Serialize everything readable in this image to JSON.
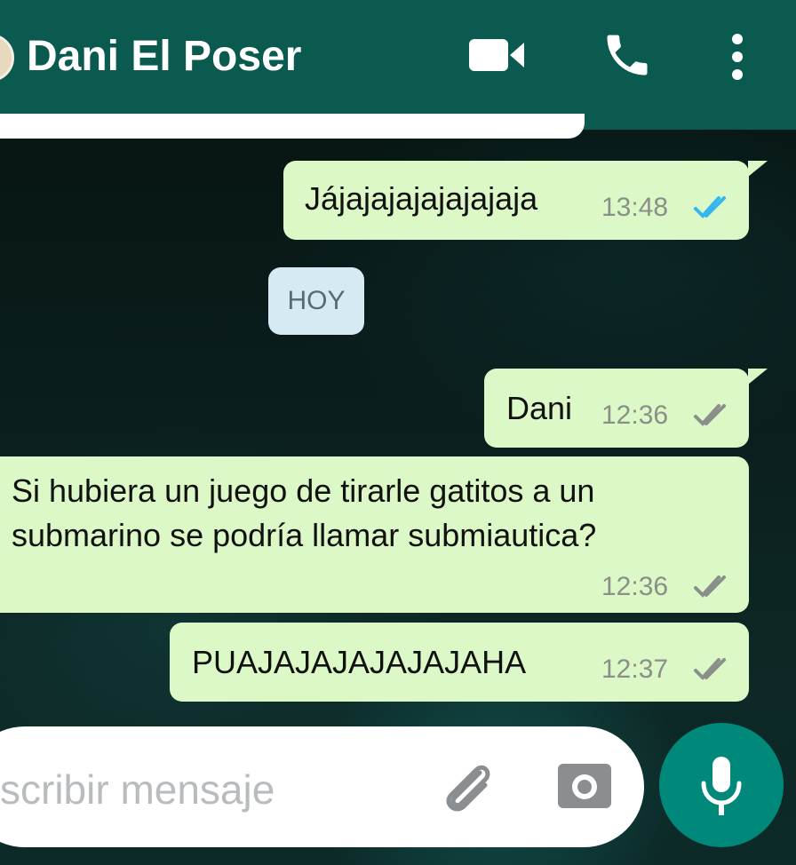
{
  "header": {
    "contact_name": "Dani El Poser",
    "icons": [
      "video-call-icon",
      "phone-icon",
      "more-vertical-icon"
    ],
    "background_color": "#0b5a4f"
  },
  "messages": [
    {
      "direction": "outgoing",
      "text": "Jájajajajajajajaja",
      "time": "13:48",
      "status": "read"
    },
    {
      "direction": "outgoing",
      "text": "Dani",
      "time": "12:36",
      "status": "delivered"
    },
    {
      "direction": "incoming",
      "lines": [
        "Si hubiera un juego de tirarle gatitos a un",
        "submarino se podría llamar submiautica?"
      ],
      "time": "12:36",
      "status": "delivered"
    },
    {
      "direction": "outgoing",
      "text": "PUAJAJAJAJAJAJAHA",
      "time": "12:37",
      "status": "delivered"
    }
  ],
  "day_separator": "HOY",
  "composer": {
    "placeholder": "scribir mensaje",
    "icons": [
      "paperclip-icon",
      "camera-icon",
      "microphone-icon"
    ],
    "mic_button_color": "#00897b"
  },
  "colors": {
    "bubble": "#dcf8c6",
    "read_ticks": "#34b7f1",
    "delivered_ticks": "#8a8f8a"
  }
}
